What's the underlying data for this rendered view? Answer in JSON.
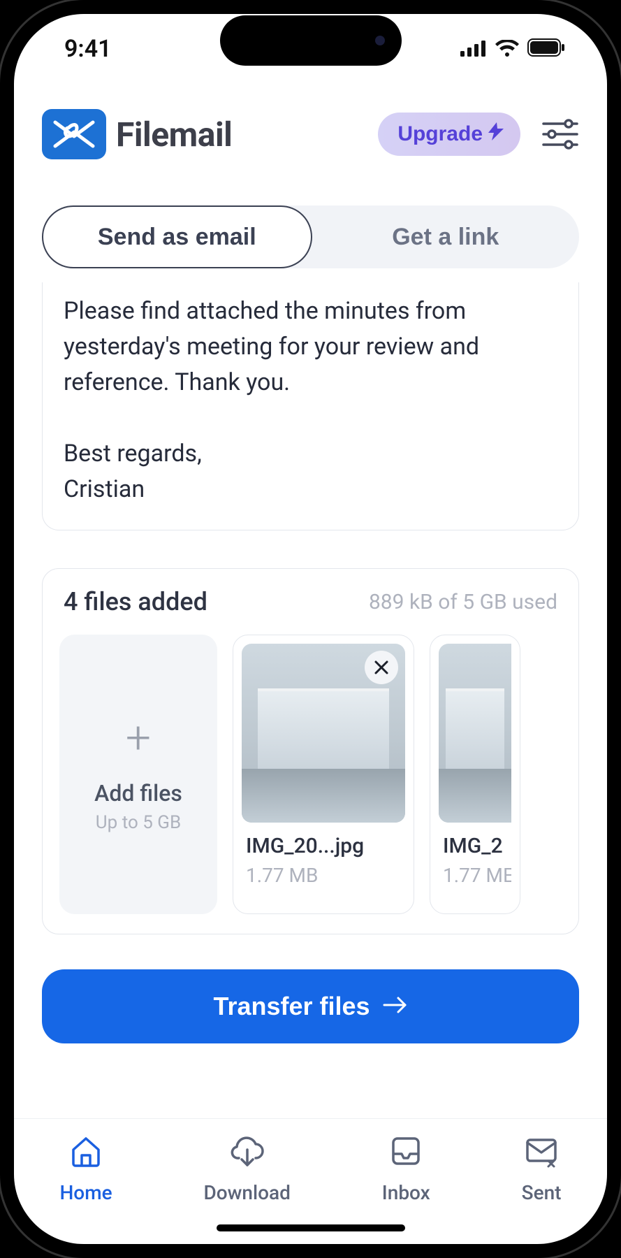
{
  "status": {
    "time": "9:41"
  },
  "header": {
    "brand": "Filemail",
    "upgrade_label": "Upgrade"
  },
  "tabs": {
    "send_email": "Send as email",
    "get_link": "Get a link"
  },
  "message": {
    "body": "Please find attached the minutes from yesterday's meeting for your review and reference. Thank you.\n\nBest regards,\nCristian"
  },
  "files": {
    "count_label": "4 files added",
    "usage_label": "889 kB of 5 GB used",
    "add_label": "Add files",
    "add_sub": "Up to 5 GB",
    "items": [
      {
        "name": "IMG_20...jpg",
        "size": "1.77 MB"
      },
      {
        "name": "IMG_2",
        "size": "1.77 ME"
      }
    ]
  },
  "transfer": {
    "label": "Transfer files"
  },
  "tabbar": {
    "home": "Home",
    "download": "Download",
    "inbox": "Inbox",
    "sent": "Sent"
  }
}
